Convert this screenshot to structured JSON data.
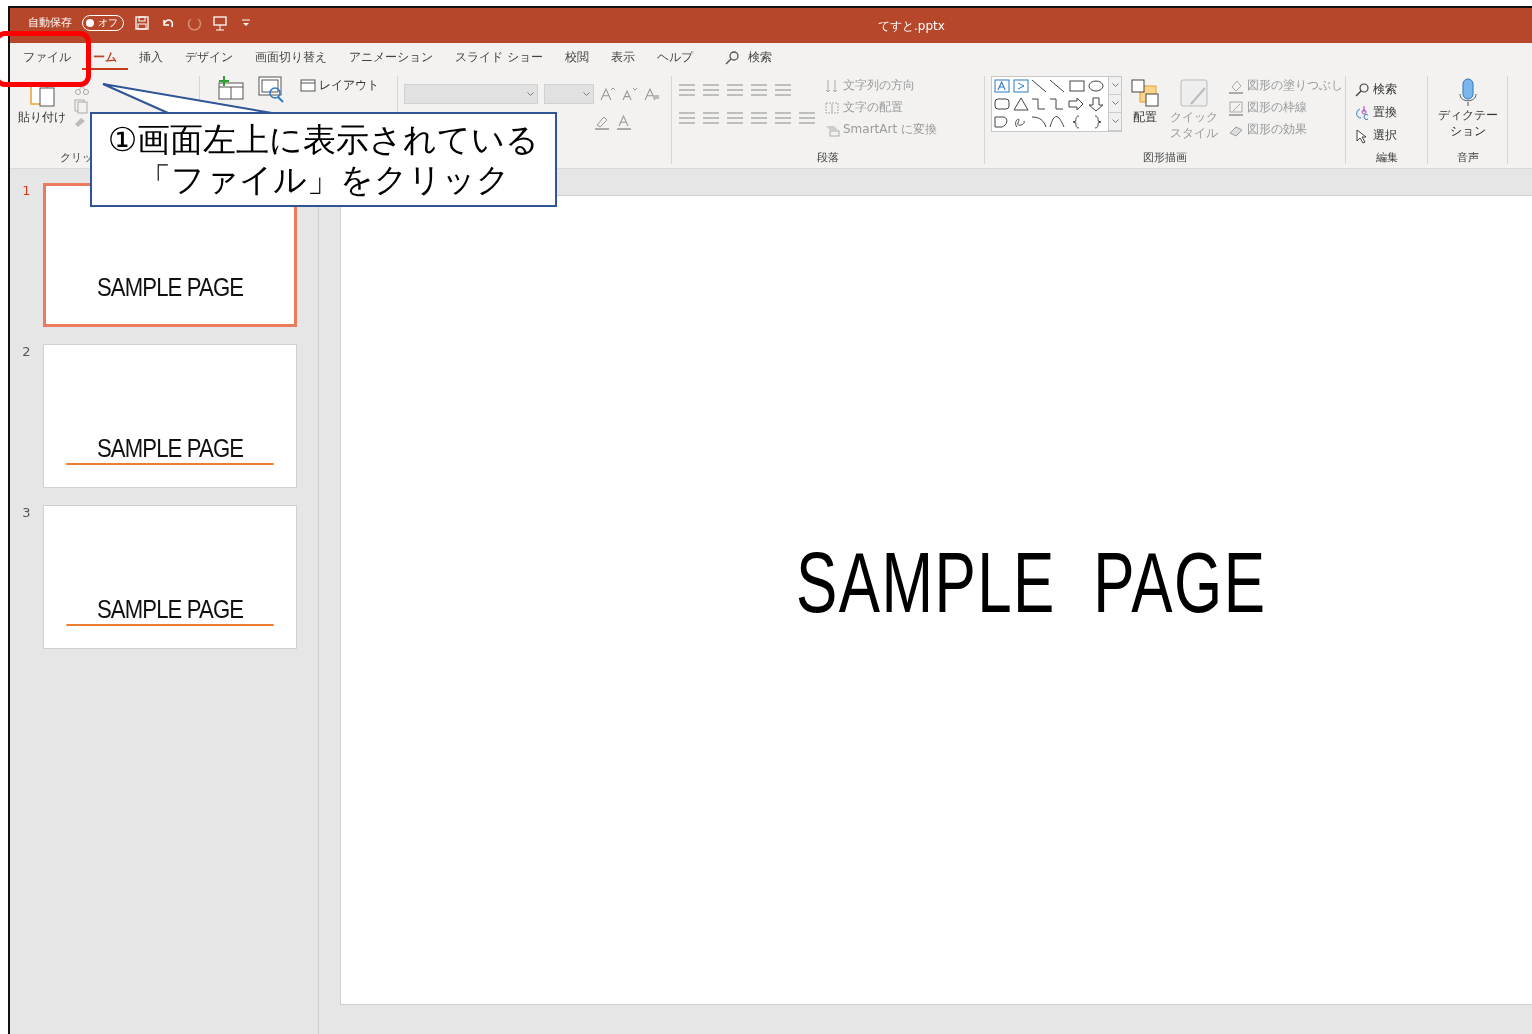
{
  "title_bar": {
    "autosave_label": "自動保存",
    "autosave_toggle": {
      "label": "オフ",
      "on": false
    },
    "file_name": "てすと.pptx"
  },
  "tabs": [
    {
      "label": "ファイル",
      "selected": false
    },
    {
      "label": "ーム",
      "selected": true
    },
    {
      "label": "挿入",
      "selected": false
    },
    {
      "label": "デザイン",
      "selected": false
    },
    {
      "label": "画面切り替え",
      "selected": false
    },
    {
      "label": "アニメーション",
      "selected": false
    },
    {
      "label": "スライド ショー",
      "selected": false
    },
    {
      "label": "校閲",
      "selected": false
    },
    {
      "label": "表示",
      "selected": false
    },
    {
      "label": "ヘルプ",
      "selected": false
    }
  ],
  "search": {
    "label": "検索"
  },
  "clipboard": {
    "paste": {
      "label": "貼り付け",
      "disabled": false
    },
    "group_label": "クリッ"
  },
  "slides_group": {
    "layout": {
      "label": "レイアウト",
      "disabled": false
    }
  },
  "paragraph": {
    "text_direction": {
      "label": "文字列の方向",
      "disabled": true
    },
    "align_text": {
      "label": "文字の配置",
      "disabled": true
    },
    "smartart": {
      "label": "SmartArt に変換",
      "disabled": true
    },
    "group_label": "段落"
  },
  "drawing": {
    "arrange": {
      "label": "配置",
      "disabled": false
    },
    "quick_styles": {
      "lines": [
        "クイック",
        "スタイル"
      ],
      "disabled": true
    },
    "fill": {
      "label": "図形の塗りつぶし",
      "disabled": true
    },
    "outline": {
      "label": "図形の枠線",
      "disabled": true
    },
    "effects": {
      "label": "図形の効果",
      "disabled": true
    },
    "group_label": "図形描画"
  },
  "editing": {
    "find": {
      "label": "検索",
      "disabled": false
    },
    "replace": {
      "label": "置換",
      "disabled": false
    },
    "select": {
      "label": "選択",
      "disabled": false
    },
    "group_label": "編集"
  },
  "voice": {
    "dictate": {
      "lines": [
        "ディクテー",
        "ション"
      ],
      "disabled": false
    },
    "group_label": "音声"
  },
  "slides": [
    {
      "number": "1",
      "title": "SAMPLE PAGE",
      "selected": true,
      "underlined": false
    },
    {
      "number": "2",
      "title": "SAMPLE PAGE",
      "selected": false,
      "underlined": true
    },
    {
      "number": "3",
      "title": "SAMPLE PAGE",
      "selected": false,
      "underlined": true
    }
  ],
  "main_slide": {
    "title": "SAMPLE PAGE"
  },
  "callout": {
    "lines": [
      "①画面左上に表示されている",
      "「ファイル」をクリック"
    ]
  }
}
